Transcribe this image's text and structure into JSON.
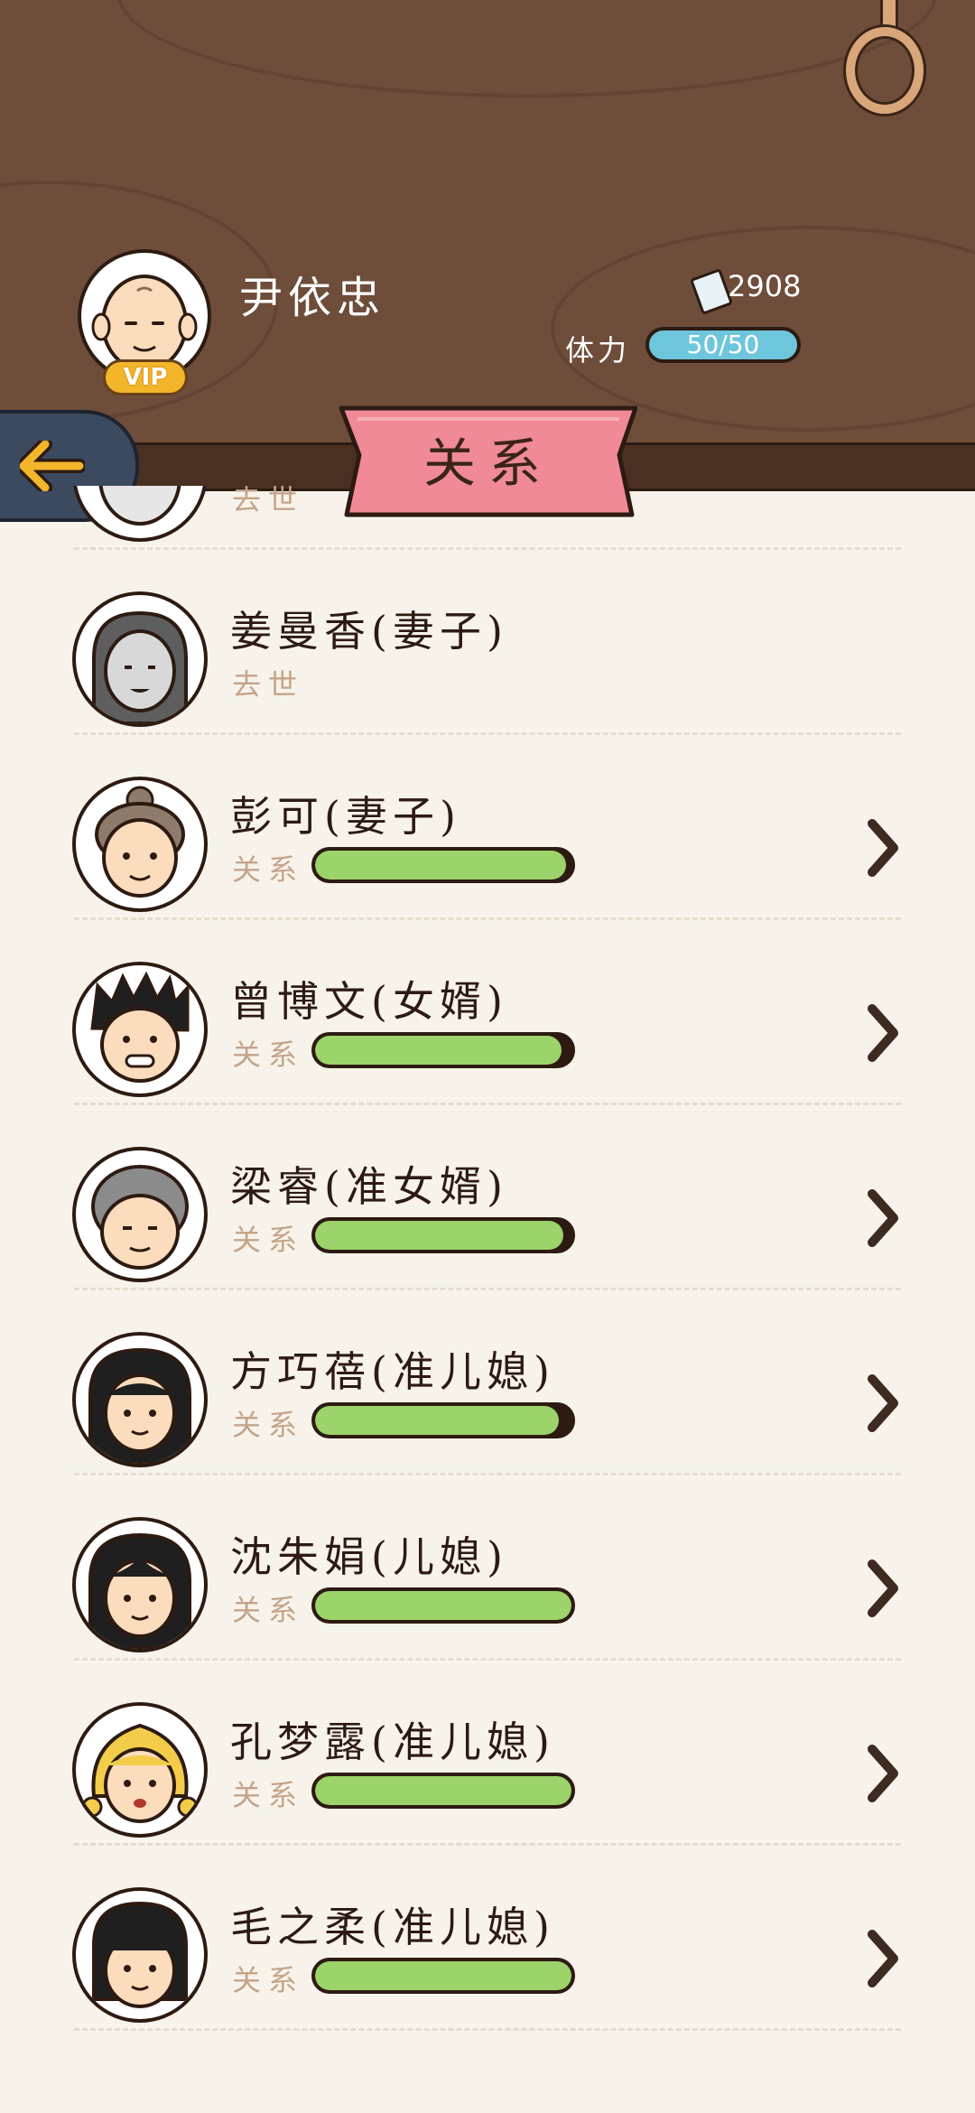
{
  "header": {
    "player_name": "尹依忠",
    "vip_label": "VIP",
    "money": "2908",
    "stamina_label": "体力",
    "stamina_value": "50/50",
    "title": "关系"
  },
  "relationships": [
    {
      "name": "",
      "status": "去世",
      "deceased": true,
      "portrait": "grey-elder"
    },
    {
      "name": "姜曼香(妻子)",
      "status": "去世",
      "deceased": true,
      "portrait": "grey-elder-woman"
    },
    {
      "name": "彭可(妻子)",
      "status": "关系",
      "level": 0.98,
      "portrait": "elder-woman-bun"
    },
    {
      "name": "曾博文(女婿)",
      "status": "关系",
      "level": 0.96,
      "portrait": "spiky-hair-man"
    },
    {
      "name": "梁睿(准女婿)",
      "status": "关系",
      "level": 0.97,
      "portrait": "grey-hair-man"
    },
    {
      "name": "方巧蓓(准儿媳)",
      "status": "关系",
      "level": 0.95,
      "portrait": "long-hair-woman"
    },
    {
      "name": "沈朱娟(儿媳)",
      "status": "关系",
      "level": 1.0,
      "portrait": "long-hair-woman"
    },
    {
      "name": "孔梦露(准儿媳)",
      "status": "关系",
      "level": 1.0,
      "portrait": "blonde-woman"
    },
    {
      "name": "毛之柔(准儿媳)",
      "status": "关系",
      "level": 1.0,
      "portrait": "bob-hair-woman"
    }
  ],
  "colors": {
    "wood": "#6e4d3b",
    "ribbon": "#f08a97",
    "relation_fill": "#9cd36a",
    "stamina": "#6ec6dc"
  }
}
